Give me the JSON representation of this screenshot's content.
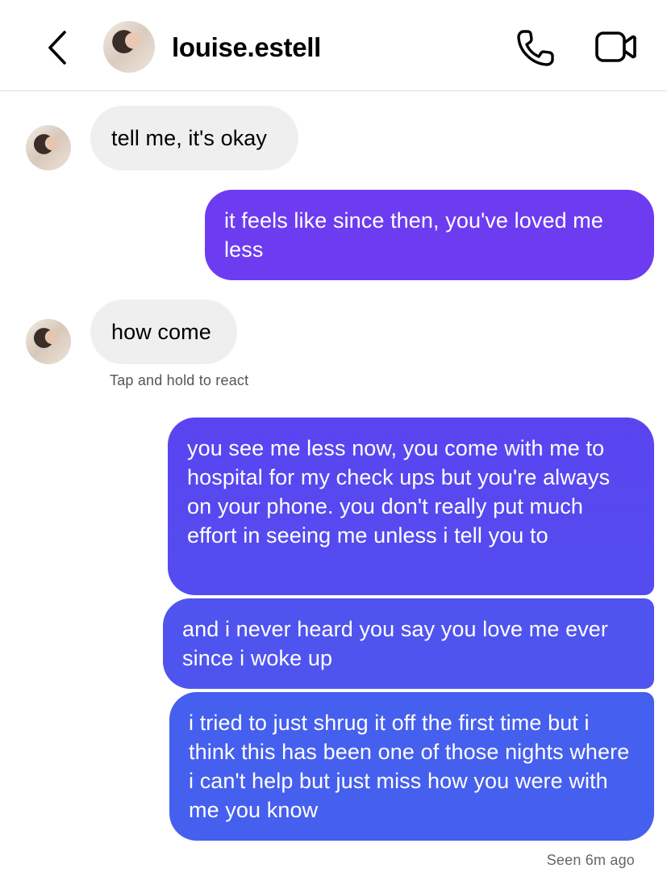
{
  "header": {
    "title": "louise.estell",
    "back_icon": "chevron-left-icon",
    "call_icon": "phone-icon",
    "video_icon": "video-camera-icon"
  },
  "messages": [
    {
      "from": "them",
      "text": "tell me, it's okay"
    },
    {
      "from": "me",
      "text": "it feels like since then, you've loved me less"
    },
    {
      "from": "them",
      "text": "how come"
    },
    {
      "from": "me",
      "text": "you see me less now, you come with me to hospital for my check ups but you're always on your phone. you don't really put much effort in seeing me unless i tell you to"
    },
    {
      "from": "me",
      "text": "and i never heard you say you love me ever since i woke up"
    },
    {
      "from": "me",
      "text": "i tried to just shrug it off the first time but i think this has been one of those nights where i can't help but just miss how you were with me you know"
    }
  ],
  "hint": "Tap and hold to react",
  "status": "Seen 6m ago",
  "colors": {
    "incoming_bubble": "#efefef",
    "outgoing_top": "#6b3ef0",
    "outgoing_bottom": "#4a5cec",
    "divider": "#dcdcdc"
  }
}
